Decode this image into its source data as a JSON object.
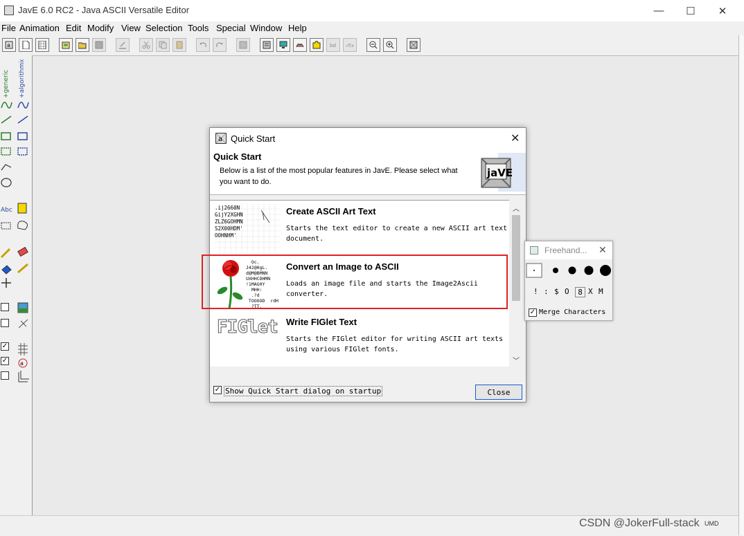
{
  "window": {
    "title": "JavE 6.0 RC2 - Java ASCII Versatile Editor",
    "controls": {
      "minimize": "—",
      "maximize": "☐",
      "close": "✕"
    }
  },
  "menubar": [
    "File",
    "Animation",
    "Edit",
    "Modify",
    "View",
    "Selection",
    "Tools",
    "Special",
    "Window",
    "Help"
  ],
  "palette": {
    "tab_generic": "+generic",
    "tab_algorithmic": "+algorithmic",
    "text_tool": "Abc",
    "checks": [
      false,
      false,
      true,
      true,
      false
    ]
  },
  "dialog": {
    "title": "Quick Start",
    "heading": "Quick Start",
    "description_line1": "Below is a list of the most popular features in JavE. Please select what",
    "description_line2": "you want to do.",
    "logo_text": "jaVE",
    "items": [
      {
        "title": "Create ASCII Art Text",
        "desc_line1": "Starts the text editor to create a new ASCII art text",
        "desc_line2": "document.",
        "thumb_text": ".ij2660N\nGijY2XGHN\nZLZ6GOHMN\nS2X00HDM'\nOOHNHM'"
      },
      {
        "title": "Convert an Image to ASCII",
        "desc_line1": "Loads an image file and starts the Image2Ascii",
        "desc_line2": "converter.",
        "thumb_text": "  Oc.\nJ42@0gL.\nd@M@BMNN\nUXHHCDHMN\n!1MAG0Y\n  MHH:\n  .?d\n TOOOOD  rdH\n  ?TT."
      },
      {
        "title": "Write FIGlet Text",
        "desc_line1": "Starts the FIGlet editor for writing ASCII art texts",
        "desc_line2": "using various FIGlet fonts.",
        "thumb_text": "FIGlet"
      }
    ],
    "checkbox_label": "Show Quick Start dialog on startup",
    "checkbox_checked": true,
    "close_button": "Close"
  },
  "freehand": {
    "title": "Freehand...",
    "chars": [
      "!",
      ":",
      "$",
      "O",
      "8",
      "X",
      "M"
    ],
    "merge_label": "Merge Characters",
    "merge_checked": true
  },
  "statusbar": {
    "right_text": "UMD"
  },
  "watermark": "CSDN @JokerFull-stack",
  "colors": {
    "highlight": "#e02020",
    "canvas": "#eaeaea",
    "dialog_bg": "#f0f0f0"
  }
}
